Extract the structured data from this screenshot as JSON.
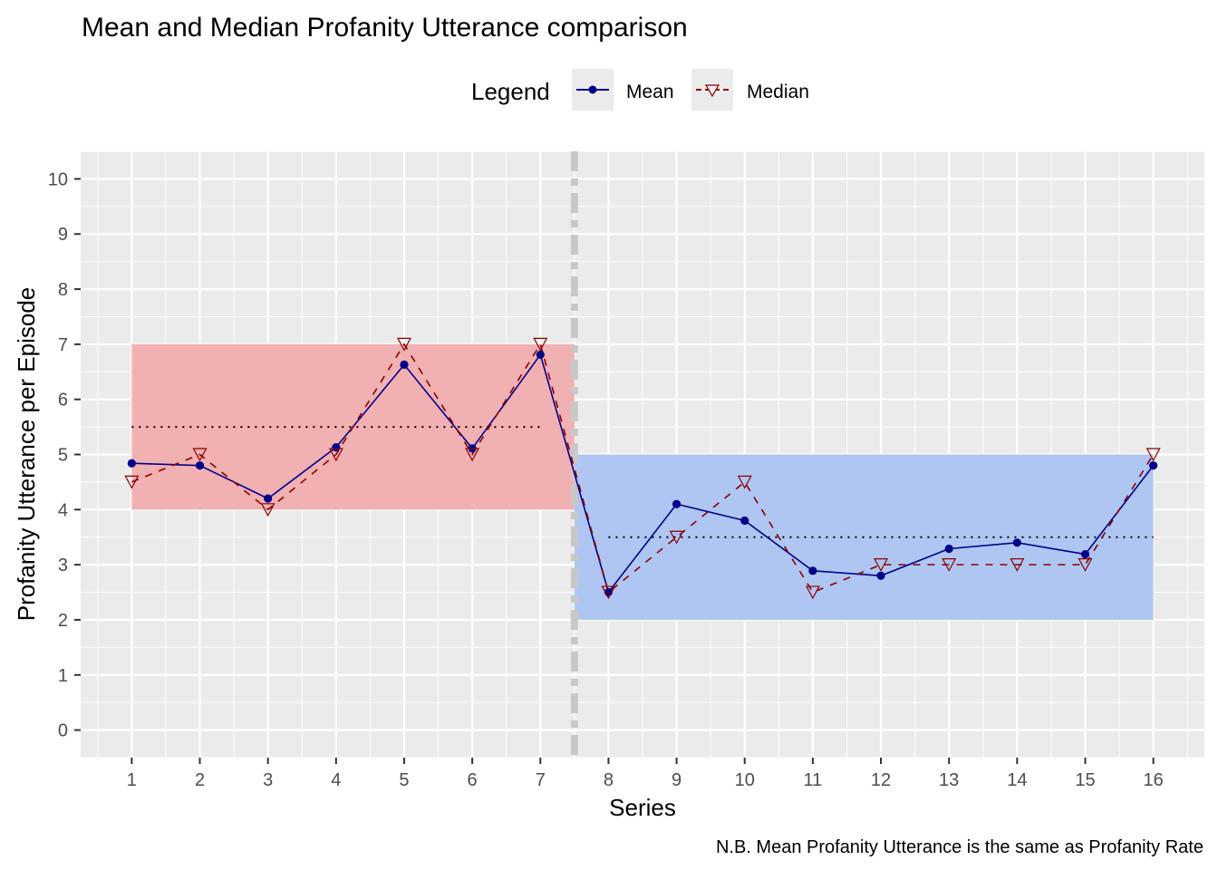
{
  "chart_data": {
    "type": "line",
    "title": "Mean and Median Profanity Utterance comparison",
    "xlabel": "Series",
    "ylabel": "Profanity Utterance per Episode",
    "caption": "N.B. Mean Profanity Utterance is the same as Profanity Rate",
    "legend": {
      "title": "Legend",
      "position": "top",
      "entries": [
        "Mean",
        "Median"
      ]
    },
    "x": [
      1,
      2,
      3,
      4,
      5,
      6,
      7,
      8,
      9,
      10,
      11,
      12,
      13,
      14,
      15,
      16
    ],
    "x_ticks": [
      "1",
      "2",
      "3",
      "4",
      "5",
      "6",
      "7",
      "8",
      "9",
      "10",
      "11",
      "12",
      "13",
      "14",
      "15",
      "16"
    ],
    "y_ticks": [
      "0",
      "1",
      "2",
      "3",
      "4",
      "5",
      "6",
      "7",
      "8",
      "9",
      "10"
    ],
    "xlim": [
      0.25,
      16.75
    ],
    "ylim": [
      -0.5,
      10.5
    ],
    "grid": true,
    "series": [
      {
        "name": "Mean",
        "color": "#00008B",
        "line": "solid",
        "marker": "circle",
        "values": [
          4.84,
          4.8,
          4.2,
          5.13,
          6.63,
          5.11,
          6.81,
          2.5,
          4.1,
          3.8,
          2.89,
          2.8,
          3.29,
          3.4,
          3.19,
          4.8
        ]
      },
      {
        "name": "Median",
        "color": "#8B0000",
        "line": "dashed",
        "marker": "triangle-down",
        "values": [
          4.5,
          5,
          4,
          5,
          7,
          5,
          7,
          2.5,
          3.5,
          4.5,
          2.5,
          3,
          3,
          3,
          3,
          5
        ]
      }
    ],
    "annotations": {
      "rectangles": [
        {
          "name": "early-series-band",
          "x": [
            1,
            7.5
          ],
          "y": [
            4,
            7
          ],
          "color": "#F1B0B1"
        },
        {
          "name": "later-series-band",
          "x": [
            7.5,
            16
          ],
          "y": [
            2,
            5
          ],
          "color": "#AFC6F2"
        }
      ],
      "hlines": [
        {
          "name": "early-average",
          "x": [
            1,
            7
          ],
          "y": 5.5,
          "style": "dotted",
          "color": "#000000"
        },
        {
          "name": "later-average",
          "x": [
            8,
            16
          ],
          "y": 3.5,
          "style": "dotted",
          "color": "#000000"
        }
      ],
      "vlines": [
        {
          "name": "era-divider",
          "x": 7.5,
          "style": "dotdash",
          "color": "#C8C8C8"
        }
      ]
    }
  }
}
